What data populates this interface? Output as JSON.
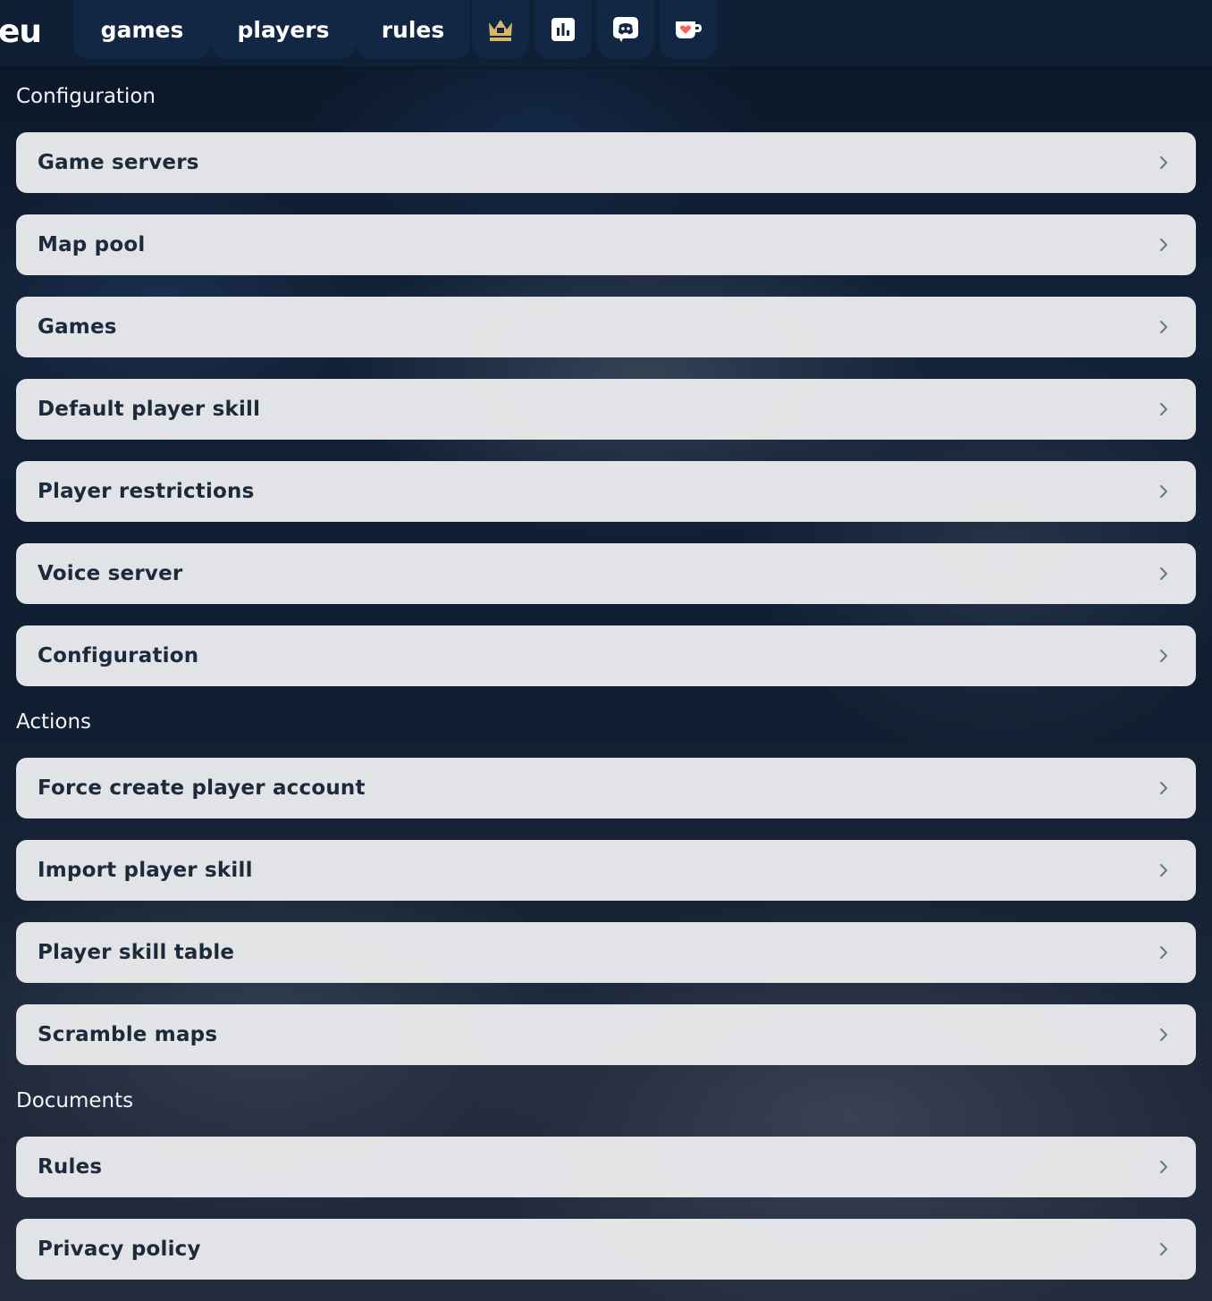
{
  "header": {
    "logo_fragment": "eu",
    "nav": [
      {
        "label": "games"
      },
      {
        "label": "players"
      },
      {
        "label": "rules"
      }
    ],
    "icons": [
      {
        "name": "crown-icon",
        "color": "#d9b56a"
      },
      {
        "name": "stats-icon",
        "color": "#ffffff"
      },
      {
        "name": "discord-icon",
        "color": "#ffffff"
      },
      {
        "name": "kofi-cup-icon",
        "color": "#ffffff",
        "accent": "#ff5e5b"
      }
    ]
  },
  "sections": [
    {
      "title": "Configuration",
      "items": [
        {
          "label": "Game servers"
        },
        {
          "label": "Map pool"
        },
        {
          "label": "Games"
        },
        {
          "label": "Default player skill"
        },
        {
          "label": "Player restrictions"
        },
        {
          "label": "Voice server"
        },
        {
          "label": "Configuration"
        }
      ]
    },
    {
      "title": "Actions",
      "items": [
        {
          "label": "Force create player account"
        },
        {
          "label": "Import player skill"
        },
        {
          "label": "Player skill table"
        },
        {
          "label": "Scramble maps"
        }
      ]
    },
    {
      "title": "Documents",
      "items": [
        {
          "label": "Rules"
        },
        {
          "label": "Privacy policy"
        }
      ]
    }
  ],
  "colors": {
    "topbar": "#0e1f36",
    "row_background": "#eaebed",
    "row_text": "#1d2a3b",
    "chevron": "#6b7280"
  }
}
